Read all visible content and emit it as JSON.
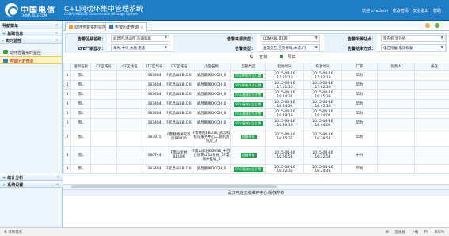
{
  "header": {
    "brand_cn": "中国电信",
    "brand_en": "CHINA TELECOM",
    "system_title": "C+L网动环集中管理系统",
    "system_subtitle": "CDMA AND LTE Concentration Manage System",
    "welcome": "欢迎 cl-admin",
    "links": [
      "修改密码",
      "安全退出",
      "帮助"
    ]
  },
  "sidebar": {
    "title": "导航菜单",
    "groups": [
      {
        "label": "基础信息",
        "sign": "+"
      },
      {
        "label": "实时监控",
        "sign": "-"
      }
    ],
    "items": [
      {
        "label": "动环告警实时监控",
        "active": false
      },
      {
        "label": "告警历史查询",
        "active": true
      }
    ],
    "bottom_groups": [
      {
        "label": "统计分析",
        "sign": "+"
      },
      {
        "label": "系统设置",
        "sign": "+"
      }
    ]
  },
  "tabs": [
    {
      "label": "动环告警实时监控"
    },
    {
      "label": "告警历史查询"
    }
  ],
  "filters": {
    "row1": [
      {
        "label": "告警区县名称：",
        "value": "武昌区,洪山区,东湖高新"
      },
      {
        "label": "告警来源类型：",
        "value": "CDMA机,LTE网"
      },
      {
        "label": "告警所属站点：",
        "value": "室内机,室外机"
      }
    ],
    "row2": [
      {
        "label": "LTE厂家显示：",
        "value": "华为,中兴,大唐,诺基"
      },
      {
        "label": "告警类型：",
        "value": "直流欠压,交流停电,水浸,门"
      },
      {
        "label": "告警结束方式：",
        "value": "电压恢复,电流恢复"
      }
    ]
  },
  "actions": {
    "search": "查询",
    "export": "导出"
  },
  "table": {
    "columns": [
      "逻辑名称",
      "CF区域号",
      "CF区域名",
      "LTE区域号",
      "LTE区域名",
      "小区名称",
      "告警类型",
      "起始时间",
      "恢复时间",
      "厂家",
      "负责人",
      "备注"
    ],
    "rows": [
      {
        "no": "1",
        "c1": "鄂L",
        "c2": "",
        "c3": "",
        "c4": "383484",
        "c5": "F武昌山BBU20",
        "c6": "武昌紫阁OCQH_0",
        "tag": "RRU供电开关已跳",
        "start": "2015-04-16\n17:01:10",
        "end": "2015-04-16\n17:02:19",
        "vendor": "华为",
        "owner": "",
        "remark": ""
      },
      {
        "no": "2",
        "c1": "鄂L",
        "c2": "",
        "c3": "",
        "c4": "383484",
        "c5": "F武昌山BBU20",
        "c6": "武昌紫阁OCQH_0",
        "tag": "RRU供电开关已跳",
        "start": "2015-04-16\n17:01:10",
        "end": "2015-04-16\n17:02:19",
        "vendor": "华为",
        "owner": "",
        "remark": ""
      },
      {
        "no": "3",
        "c1": "鄂L",
        "c2": "",
        "c3": "",
        "c4": "383484",
        "c5": "F武昌山BBU20",
        "c6": "武昌紫阁OCQH_0",
        "tag": "RRU直流欠压告警",
        "start": "2015-04-16\n16:44:32",
        "end": "2015-04-16\n16:45:39",
        "vendor": "华为",
        "owner": "",
        "remark": ""
      },
      {
        "no": "4",
        "c1": "鄂L",
        "c2": "",
        "c3": "",
        "c4": "383484",
        "c5": "F武昌山BBU20",
        "c6": "武昌紫阁OCQH_0",
        "tag": "RRU直流欠压告警",
        "start": "2015-04-16\n16:44:32",
        "end": "2015-04-16\n16:45:39",
        "vendor": "华为",
        "owner": "",
        "remark": ""
      },
      {
        "no": "5",
        "c1": "鄂L",
        "c2": "",
        "c3": "",
        "c4": "383484",
        "c5": "F武昌山BBU20",
        "c6": "武昌紫阁OCQH_0",
        "tag": "RRU直流欠压告警",
        "start": "2015-04-16\n16:39:19",
        "end": "2015-04-16\n16:44:02",
        "vendor": "华为",
        "owner": "",
        "remark": ""
      },
      {
        "no": "6",
        "c1": "鄂L",
        "c2": "",
        "c3": "",
        "c4": "383484",
        "c5": "F武昌山BBU20",
        "c6": "武昌紫阁OCQH_0",
        "tag": "RRU直流欠压告警",
        "start": "2015-04-16\n16:39:19",
        "end": "2015-04-16\n16:44:02",
        "vendor": "华为",
        "owner": "",
        "remark": ""
      },
      {
        "no": "7",
        "c1": "鄂L",
        "c2": "",
        "c3": "",
        "c4": "383975",
        "c5": "F鲁巷图书馆机房BBU36",
        "c6": "F鲁巷图BBU36_武汉科技馆服务中心二期机房机房_0",
        "tag": "设备掉电",
        "start": "2015-04-16\n16:35:36",
        "end": "2015-04-16\n16:39:54",
        "vendor": "华为",
        "owner": "",
        "remark": ""
      },
      {
        "no": "8",
        "c1": "鄂L",
        "c2": "",
        "c3": "",
        "c4": "386744",
        "c5": "F南山新村BBU36",
        "c6": "F南山新村BBU36_中百仓储南山10号楼_1F电梯井挂墙_0",
        "tag": "设备掉电",
        "start": "2015-04-16\n16:26:51",
        "end": "2015-04-16\n16:32:54",
        "vendor": "中兴",
        "owner": "",
        "remark": ""
      },
      {
        "no": "9",
        "c1": "鄂L",
        "c2": "",
        "c3": "",
        "c4": "383484",
        "c5": "F武昌山BBU20",
        "c6": "武昌紫阁OCQH_0",
        "tag": "RRU直流欠压告警",
        "start": "2015-04-16\n16:22:30",
        "end": "2015-04-16\n16:24:43",
        "vendor": "华为",
        "owner": "",
        "remark": ""
      }
    ]
  },
  "footer": {
    "center": "武汉电信无线维护中心 版权所有",
    "status_left": "⊕ 清晰模式",
    "status_right": [
      "⊕",
      "加速器",
      "下载",
      "Ps",
      "100%"
    ]
  },
  "colors": {
    "header_blue": "#1f7dc6",
    "alarm_tag_green": "#1aa34a",
    "active_menu_bg": "#fff4c2"
  }
}
